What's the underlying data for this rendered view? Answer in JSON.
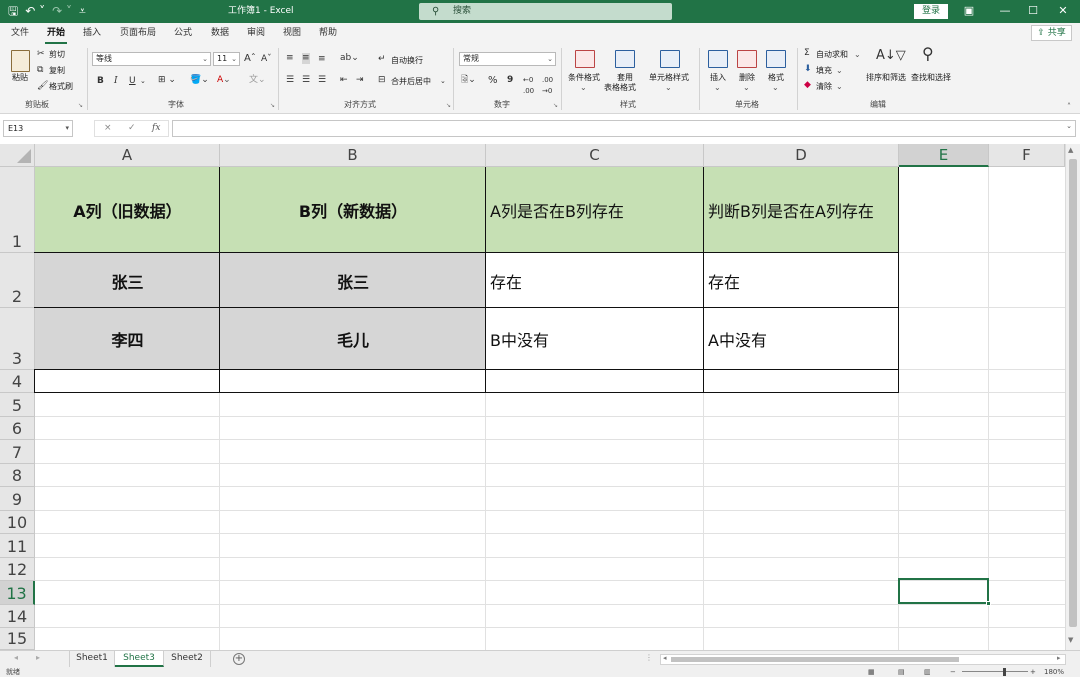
{
  "titlebar": {
    "title": "工作簿1 - Excel",
    "search_placeholder": "搜索",
    "login_label": "登录"
  },
  "tabs": [
    "文件",
    "开始",
    "插入",
    "页面布局",
    "公式",
    "数据",
    "审阅",
    "视图",
    "帮助"
  ],
  "active_tab": "开始",
  "share_label": "共享",
  "ribbon": {
    "clipboard": {
      "paste": "粘贴",
      "cut": "剪切",
      "copy": "复制",
      "format_painter": "格式刷",
      "group_label": "剪贴板"
    },
    "font": {
      "font_name": "等线",
      "font_size": "11",
      "bold": "B",
      "italic": "I",
      "underline": "U",
      "grow": "A",
      "shrink": "A",
      "group_label": "字体"
    },
    "alignment": {
      "wrap_text": "自动换行",
      "merge_center": "合并后居中",
      "group_label": "对齐方式"
    },
    "number": {
      "format": "常规",
      "percent": "%",
      "comma": "9",
      "group_label": "数字"
    },
    "styles": {
      "conditional": "条件格式",
      "table_line1": "套用",
      "table_line2": "表格格式",
      "cell_styles": "单元格样式",
      "group_label": "样式"
    },
    "cells": {
      "insert": "插入",
      "delete": "删除",
      "format": "格式",
      "group_label": "单元格"
    },
    "editing": {
      "autosum": "自动求和",
      "fill": "填充",
      "clear": "清除",
      "sort_filter": "排序和筛选",
      "find_select": "查找和选择",
      "group_label": "编辑"
    }
  },
  "formula_bar": {
    "name_box": "E13",
    "fx": "fx",
    "cancel": "×",
    "enter": "✓",
    "value": ""
  },
  "columns": [
    "A",
    "B",
    "C",
    "D",
    "E",
    "F"
  ],
  "selected_column": "E",
  "rows": [
    "1",
    "2",
    "3",
    "4",
    "5",
    "6",
    "7",
    "8",
    "9",
    "10",
    "11",
    "12",
    "13",
    "14",
    "15"
  ],
  "selected_row": "13",
  "cells": {
    "A1": "A列（旧数据）",
    "B1": "B列（新数据）",
    "C1": "A列是否在B列存在",
    "D1": "判断B列是否在A列存在",
    "A2": "张三",
    "B2": "张三",
    "C2": "存在",
    "D2": "存在",
    "A3": "李四",
    "B3": "毛儿",
    "C3": "B中没有",
    "D3": "A中没有"
  },
  "sheets": [
    "Sheet1",
    "Sheet3",
    "Sheet2"
  ],
  "active_sheet": "Sheet3",
  "status": {
    "ready": "就绪",
    "zoom": "180%"
  },
  "colors": {
    "excel_green": "#217346",
    "header_fill": "#c6e0b4",
    "gray_fill": "#d6d6d6"
  }
}
